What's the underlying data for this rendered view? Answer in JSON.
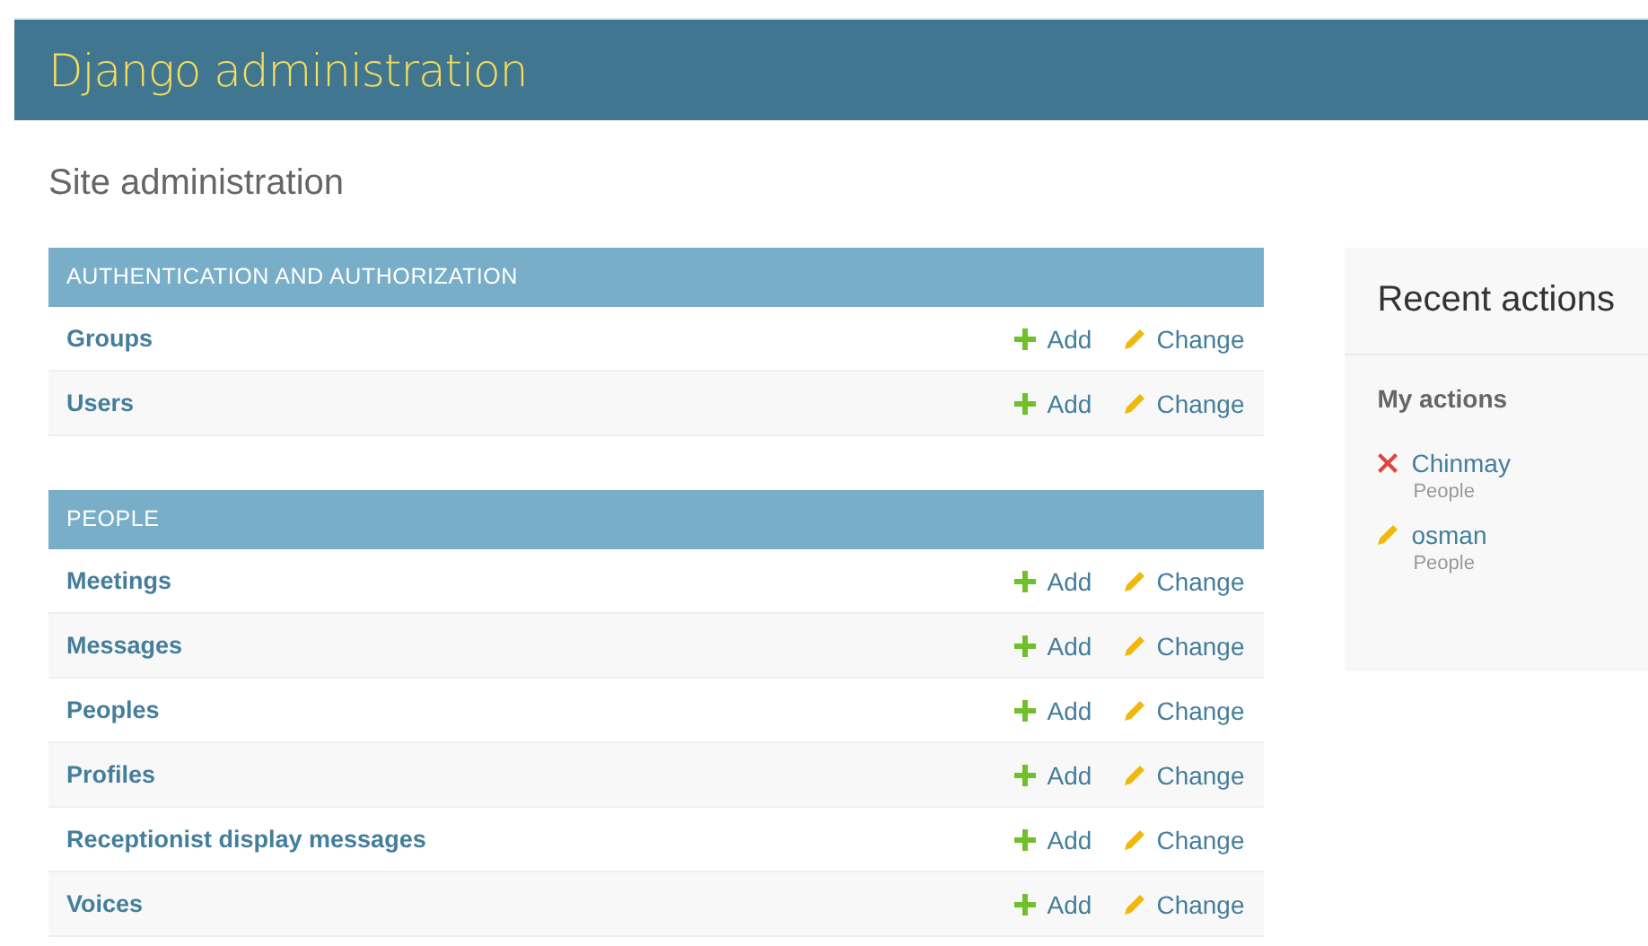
{
  "header": {
    "title": "Django administration"
  },
  "page_title": "Site administration",
  "apps": [
    {
      "caption": "AUTHENTICATION AND AUTHORIZATION",
      "models": [
        {
          "name": "Groups",
          "add": "Add",
          "change": "Change"
        },
        {
          "name": "Users",
          "add": "Add",
          "change": "Change"
        }
      ]
    },
    {
      "caption": "PEOPLE",
      "models": [
        {
          "name": "Meetings",
          "add": "Add",
          "change": "Change"
        },
        {
          "name": "Messages",
          "add": "Add",
          "change": "Change"
        },
        {
          "name": "Peoples",
          "add": "Add",
          "change": "Change"
        },
        {
          "name": "Profiles",
          "add": "Add",
          "change": "Change"
        },
        {
          "name": "Receptionist display messages",
          "add": "Add",
          "change": "Change"
        },
        {
          "name": "Voices",
          "add": "Add",
          "change": "Change"
        }
      ]
    }
  ],
  "recent_actions": {
    "title": "Recent actions",
    "subtitle": "My actions",
    "items": [
      {
        "kind": "deletion",
        "label": "Chinmay",
        "type": "People"
      },
      {
        "kind": "change",
        "label": "osman",
        "type": "People"
      }
    ]
  }
}
